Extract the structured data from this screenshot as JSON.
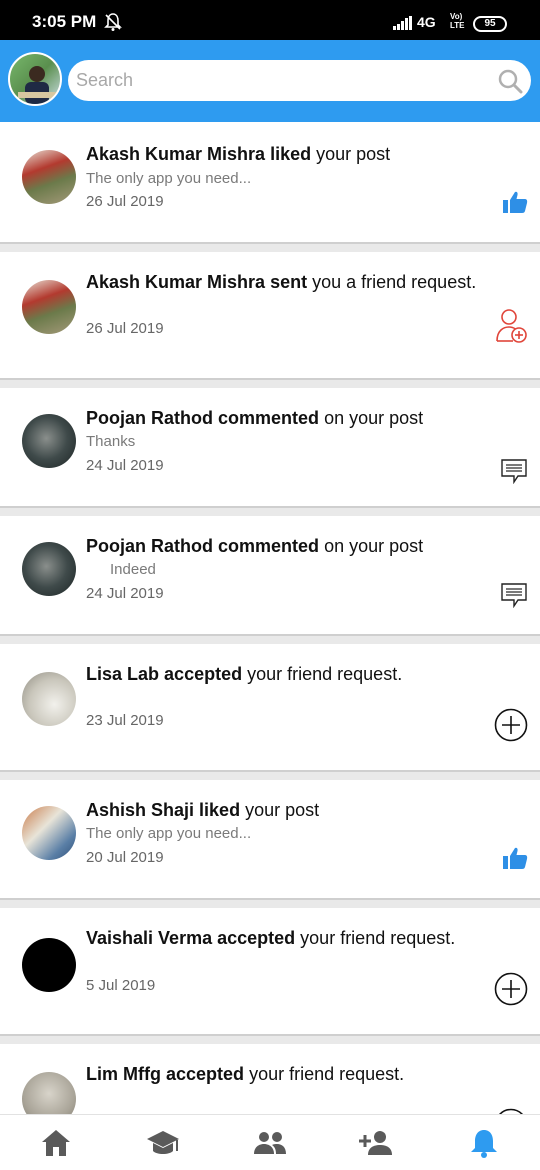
{
  "status": {
    "time": "3:05 PM",
    "network": "4G",
    "volte_top": "Vo)",
    "volte_bottom": "LTE",
    "battery": "95"
  },
  "search": {
    "placeholder": "Search"
  },
  "notifications": [
    {
      "actor": "Akash Kumar Mishra",
      "verb": "liked",
      "rest": "your post",
      "subtitle": "The only app you need...",
      "date": "26 Jul 2019",
      "action_icon": "like-icon"
    },
    {
      "actor": "Akash Kumar Mishra",
      "verb": "sent",
      "rest": "you a friend request.",
      "subtitle": "",
      "date": "26 Jul 2019",
      "action_icon": "add-friend-icon"
    },
    {
      "actor": "Poojan Rathod",
      "verb": "commented",
      "rest": "on your post",
      "subtitle": "Thanks",
      "date": "24 Jul 2019",
      "action_icon": "comment-icon"
    },
    {
      "actor": "Poojan Rathod",
      "verb": "commented",
      "rest": "on your post",
      "subtitle": "Indeed",
      "date": "24 Jul 2019",
      "action_icon": "comment-icon"
    },
    {
      "actor": "Lisa Lab",
      "verb": "accepted",
      "rest": "your friend request.",
      "subtitle": "",
      "date": "23 Jul 2019",
      "action_icon": "add-circle-icon"
    },
    {
      "actor": "Ashish Shaji",
      "verb": "liked",
      "rest": "your post",
      "subtitle": "The only app you need...",
      "date": "20 Jul 2019",
      "action_icon": "like-icon"
    },
    {
      "actor": "Vaishali Verma",
      "verb": "accepted",
      "rest": "your friend request.",
      "subtitle": "",
      "date": "5 Jul 2019",
      "action_icon": "add-circle-icon"
    },
    {
      "actor": "Lim Mffg",
      "verb": "accepted",
      "rest": "your friend request.",
      "subtitle": "",
      "date": "",
      "action_icon": "add-circle-icon"
    }
  ],
  "bottom_nav": [
    "home-icon",
    "courses-icon",
    "friends-icon",
    "add-friend-nav-icon",
    "notifications-icon"
  ],
  "colors": {
    "accent": "#2e9bf0",
    "like": "#2e8fe6",
    "add_friend": "#e0453a",
    "active_nav": "#2e9bf0",
    "nav_inactive": "#5a5a5a"
  }
}
